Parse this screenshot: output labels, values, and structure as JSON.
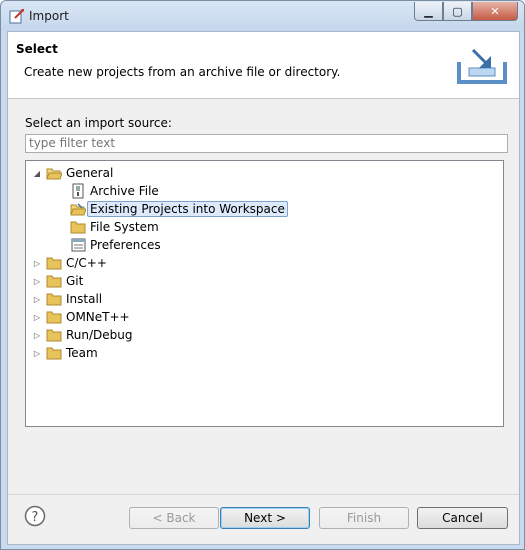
{
  "window": {
    "title": "Import"
  },
  "header": {
    "title": "Select",
    "description": "Create new projects from an archive file or directory."
  },
  "source": {
    "label": "Select an import source:",
    "filter_placeholder": "type filter text"
  },
  "tree": {
    "general": {
      "label": "General",
      "children": [
        {
          "label": "Archive File"
        },
        {
          "label": "Existing Projects into Workspace",
          "selected": true
        },
        {
          "label": "File System"
        },
        {
          "label": "Preferences"
        }
      ]
    },
    "categories": [
      {
        "label": "C/C++"
      },
      {
        "label": "Git"
      },
      {
        "label": "Install"
      },
      {
        "label": "OMNeT++"
      },
      {
        "label": "Run/Debug"
      },
      {
        "label": "Team"
      }
    ]
  },
  "buttons": {
    "back": "< Back",
    "next": "Next >",
    "finish": "Finish",
    "cancel": "Cancel"
  },
  "colors": {
    "selection": "#dceafc",
    "folder": "#e8c35a"
  }
}
